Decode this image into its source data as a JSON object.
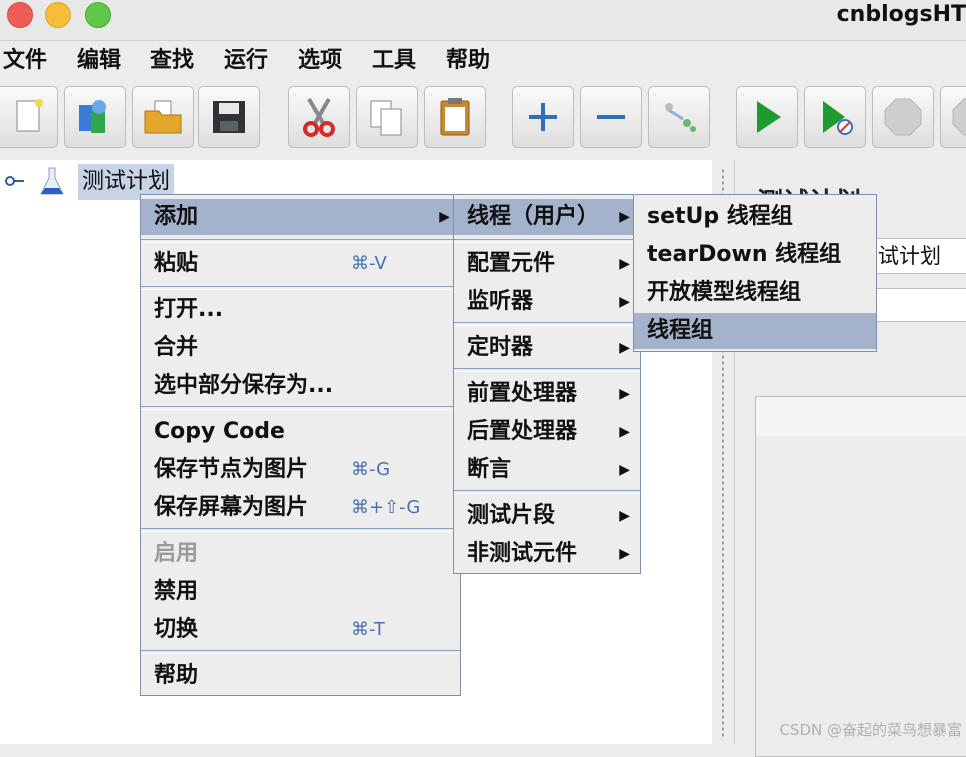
{
  "window": {
    "title": "cnblogsHT"
  },
  "menubar": {
    "items": [
      "文件",
      "编辑",
      "查找",
      "运行",
      "选项",
      "工具",
      "帮助"
    ]
  },
  "toolbar": {
    "buttons": [
      {
        "icon": "new-icon"
      },
      {
        "icon": "templates-icon"
      },
      {
        "icon": "open-icon"
      },
      {
        "icon": "save-icon"
      },
      {
        "icon": "cut-icon"
      },
      {
        "icon": "copy-icon"
      },
      {
        "icon": "paste-icon"
      },
      {
        "icon": "expand-icon"
      },
      {
        "icon": "collapse-icon"
      },
      {
        "icon": "toggle-icon"
      },
      {
        "icon": "start-icon"
      },
      {
        "icon": "start-no-pause-icon"
      },
      {
        "icon": "stop-icon"
      }
    ]
  },
  "tree": {
    "root_label": "测试计划"
  },
  "right_panel": {
    "heading": "测试计划",
    "name_value": "试计划"
  },
  "context_menu": {
    "add": "添加",
    "paste": "粘贴",
    "paste_sc": "⌘-V",
    "open": "打开...",
    "merge": "合并",
    "save_selection": "选中部分保存为...",
    "copy_code": "Copy Code",
    "save_node_image": "保存节点为图片",
    "save_node_image_sc": "⌘-G",
    "save_screen_image": "保存屏幕为图片",
    "save_screen_image_sc": "⌘+⇧-G",
    "enable": "启用",
    "disable": "禁用",
    "toggle": "切换",
    "toggle_sc": "⌘-T",
    "help": "帮助"
  },
  "add_submenu": {
    "threads": "线程（用户）",
    "config": "配置元件",
    "listener": "监听器",
    "timer": "定时器",
    "pre": "前置处理器",
    "post": "后置处理器",
    "assertion": "断言",
    "fragment": "测试片段",
    "non_test": "非测试元件"
  },
  "threads_submenu": {
    "setup": "setUp 线程组",
    "teardown": "tearDown 线程组",
    "open_model": "开放模型线程组",
    "thread_group": "线程组"
  },
  "watermark": "CSDN @奋起的菜鸟想暴富"
}
